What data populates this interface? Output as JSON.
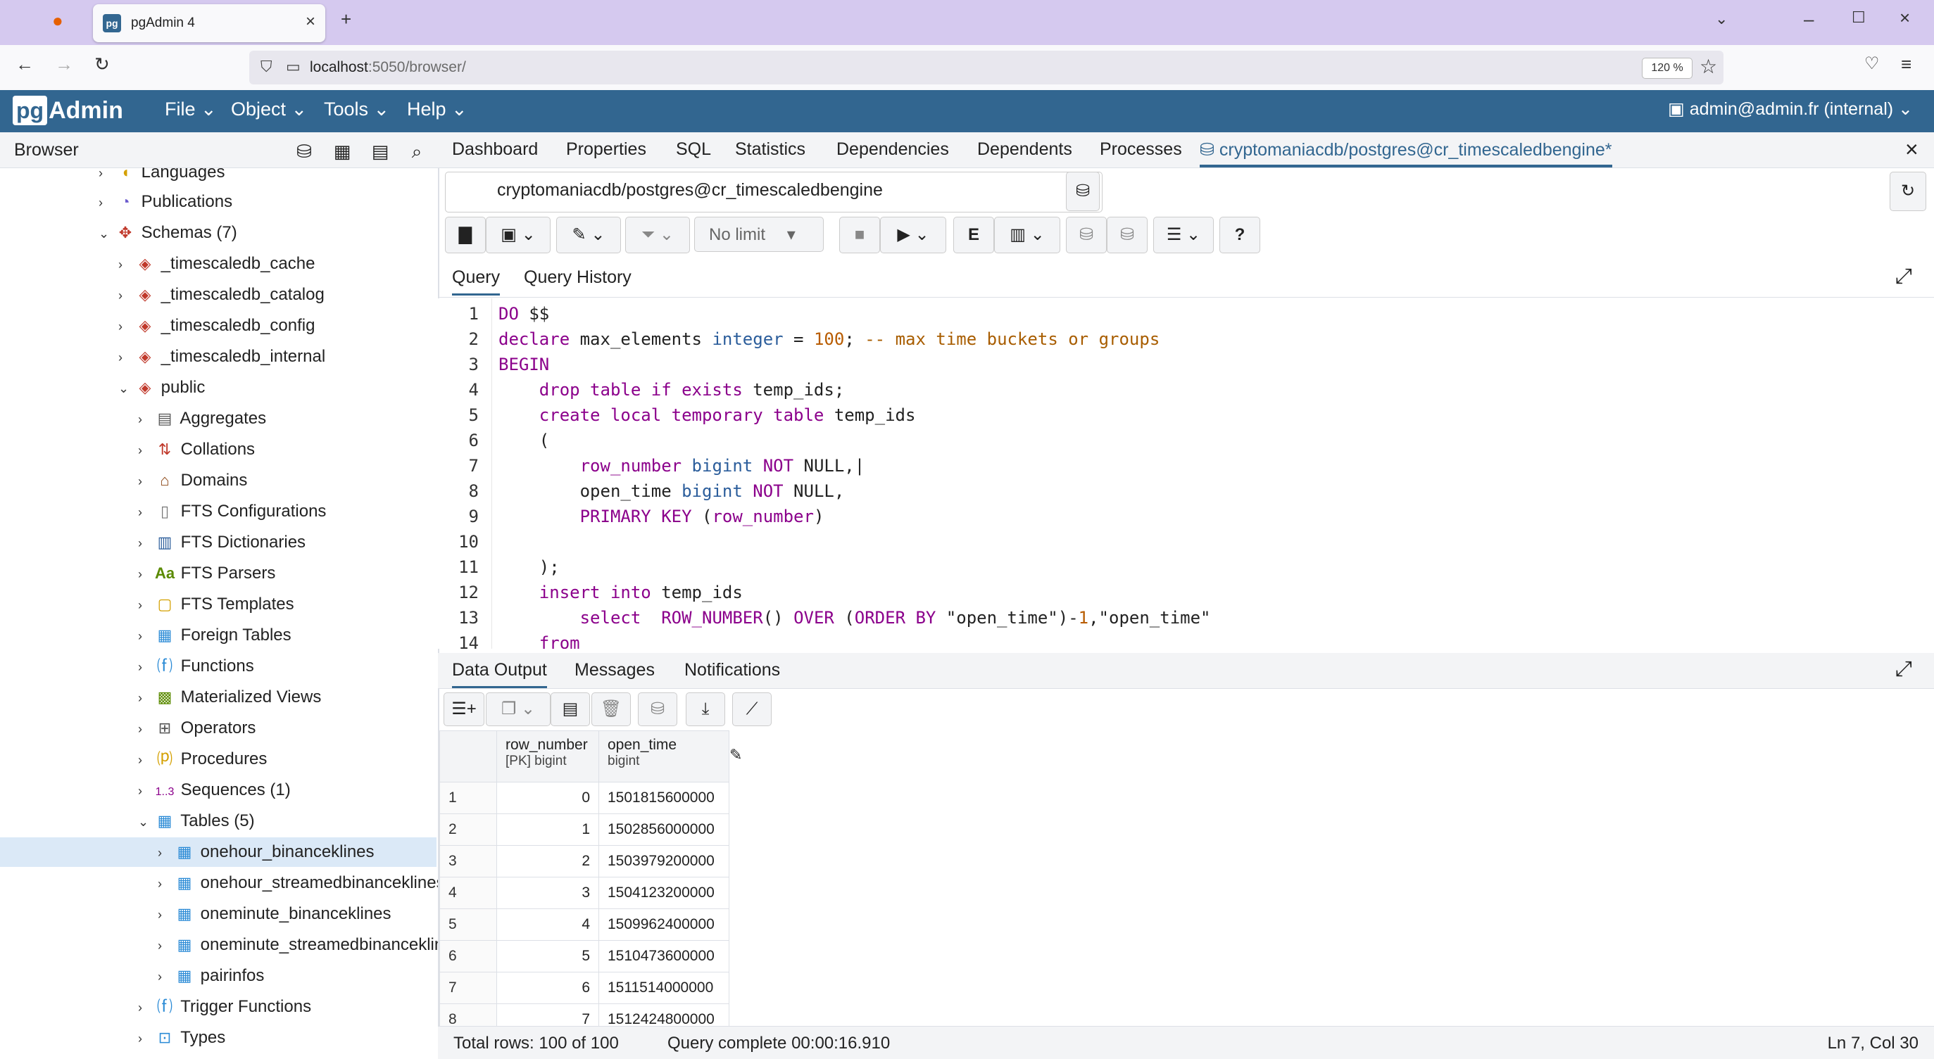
{
  "browser": {
    "tab_title": "pgAdmin 4",
    "url_host": "localhost",
    "url_path": ":5050/browser/",
    "zoom": "120 %"
  },
  "app": {
    "menus": [
      "File",
      "Object",
      "Tools",
      "Help"
    ],
    "user": "admin@admin.fr (internal)"
  },
  "browser_panel": {
    "title": "Browser",
    "nodes": [
      {
        "label": "Languages"
      },
      {
        "label": "Publications"
      },
      {
        "label": "Schemas (7)"
      },
      {
        "label": "_timescaledb_cache"
      },
      {
        "label": "_timescaledb_catalog"
      },
      {
        "label": "_timescaledb_config"
      },
      {
        "label": "_timescaledb_internal"
      },
      {
        "label": "public"
      },
      {
        "label": "Aggregates"
      },
      {
        "label": "Collations"
      },
      {
        "label": "Domains"
      },
      {
        "label": "FTS Configurations"
      },
      {
        "label": "FTS Dictionaries"
      },
      {
        "label": "FTS Parsers"
      },
      {
        "label": "FTS Templates"
      },
      {
        "label": "Foreign Tables"
      },
      {
        "label": "Functions"
      },
      {
        "label": "Materialized Views"
      },
      {
        "label": "Operators"
      },
      {
        "label": "Procedures"
      },
      {
        "label": "Sequences (1)"
      },
      {
        "label": "Tables (5)"
      },
      {
        "label": "onehour_binanceklines"
      },
      {
        "label": "onehour_streamedbinanceklines"
      },
      {
        "label": "oneminute_binanceklines"
      },
      {
        "label": "oneminute_streamedbinanceklines"
      },
      {
        "label": "pairinfos"
      },
      {
        "label": "Trigger Functions"
      },
      {
        "label": "Types"
      }
    ]
  },
  "main_tabs": [
    "Dashboard",
    "Properties",
    "SQL",
    "Statistics",
    "Dependencies",
    "Dependents",
    "Processes"
  ],
  "active_tab": "cryptomaniacdb/postgres@cr_timescaledbengine*",
  "query_tool": {
    "connection": "cryptomaniacdb/postgres@cr_timescaledbengine",
    "limit": "No limit",
    "tabs": [
      "Query",
      "Query History"
    ],
    "lines": [
      "1",
      "2",
      "3",
      "4",
      "5",
      "6",
      "7",
      "8",
      "9",
      "10",
      "11",
      "12",
      "13",
      "14"
    ]
  },
  "output": {
    "tabs": [
      "Data Output",
      "Messages",
      "Notifications"
    ],
    "columns": [
      {
        "name": "row_number",
        "type": "[PK] bigint"
      },
      {
        "name": "open_time",
        "type": "bigint"
      }
    ],
    "rows": [
      {
        "n": "1",
        "row_number": "0",
        "open_time": "1501815600000"
      },
      {
        "n": "2",
        "row_number": "1",
        "open_time": "1502856000000"
      },
      {
        "n": "3",
        "row_number": "2",
        "open_time": "1503979200000"
      },
      {
        "n": "4",
        "row_number": "3",
        "open_time": "1504123200000"
      },
      {
        "n": "5",
        "row_number": "4",
        "open_time": "1509962400000"
      },
      {
        "n": "6",
        "row_number": "5",
        "open_time": "1510473600000"
      },
      {
        "n": "7",
        "row_number": "6",
        "open_time": "1511514000000"
      },
      {
        "n": "8",
        "row_number": "7",
        "open_time": "1512424800000"
      }
    ],
    "total_rows": "Total rows: 100 of 100",
    "query_status": "Query complete 00:00:16.910",
    "cursor": "Ln 7, Col 30"
  }
}
